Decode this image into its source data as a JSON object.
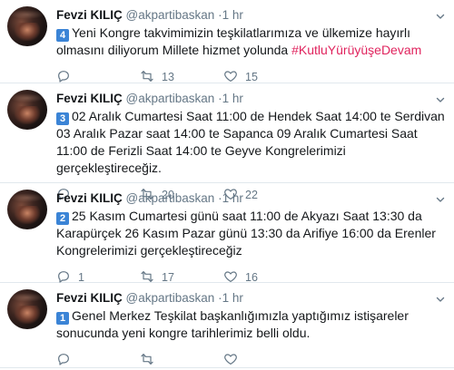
{
  "tweets": [
    {
      "name": "Fevzi KILIÇ",
      "handle": "@akpartibaskan",
      "time": "1 hr",
      "number_badge": "4",
      "text": "Yeni Kongre takvimimizin teşkilatlarımıza ve ülkemize hayırlı olmasını diliyorum Millete hizmet yolunda ",
      "hashtag": "#KutluYürüyüşeDevam",
      "replies": "",
      "retweets": "13",
      "likes": "15"
    },
    {
      "name": "Fevzi KILIÇ",
      "handle": "@akpartibaskan",
      "time": "1 hr",
      "number_badge": "3",
      "text": "02 Aralık Cumartesi Saat 11:00 de Hendek Saat 14:00 te Serdivan 03 Aralık Pazar saat 14:00 te Sapanca 09 Aralık Cumartesi Saat 11:00 de Ferizli Saat 14:00 te Geyve Kongrelerimizi gerçekleştireceğiz.",
      "hashtag": "",
      "replies": "",
      "retweets": "20",
      "likes": "22"
    },
    {
      "name": "Fevzi KILIÇ",
      "handle": "@akpartibaskan",
      "time": "1 hr",
      "number_badge": "2",
      "text": "25 Kasım Cumartesi günü saat 11:00 de Akyazı Saat 13:30 da Karapürçek 26 Kasım Pazar günü 13:30 da Arifiye 16:00 da Erenler Kongrelerimizi gerçekleştireceğiz",
      "hashtag": "",
      "replies": "1",
      "retweets": "17",
      "likes": "16"
    },
    {
      "name": "Fevzi KILIÇ",
      "handle": "@akpartibaskan",
      "time": "1 hr",
      "number_badge": "1",
      "text": "Genel Merkez Teşkilat başkanlığımızla yaptığımız istişareler sonucunda yeni kongre tarihlerimiz belli oldu.",
      "hashtag": "",
      "replies": "",
      "retweets": "",
      "likes": ""
    }
  ],
  "icons": {
    "reply": "reply-icon",
    "retweet": "retweet-icon",
    "like": "heart-icon",
    "menu": "chevron-down-icon"
  }
}
